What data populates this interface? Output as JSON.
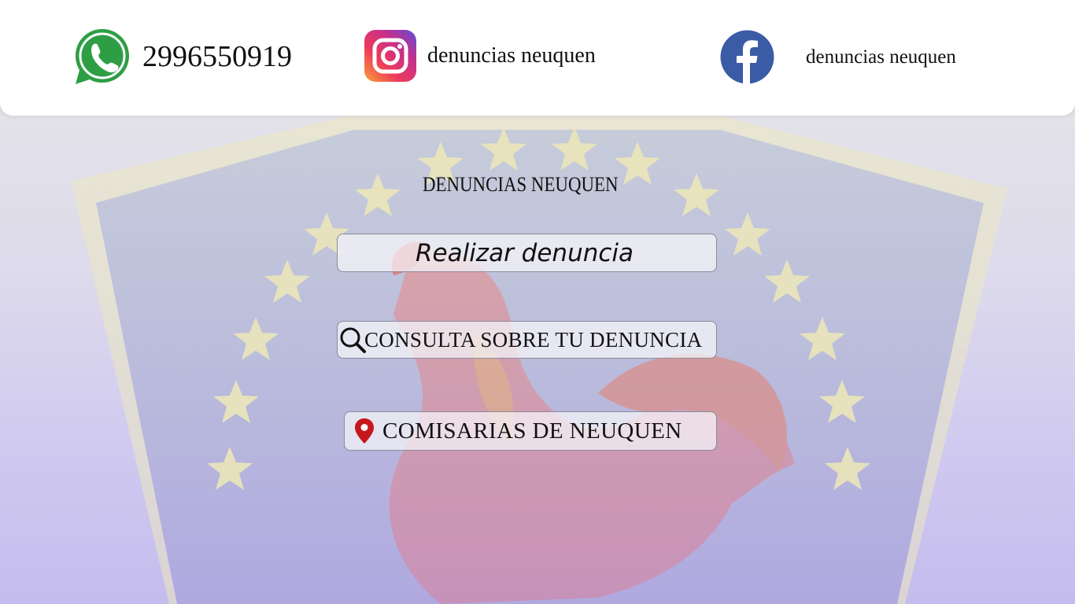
{
  "header": {
    "whatsapp": {
      "icon": "whatsapp-icon",
      "number": "2996550919",
      "color": "#2e9e45"
    },
    "instagram": {
      "icon": "instagram-icon",
      "handle": "denuncias neuquen"
    },
    "facebook": {
      "icon": "facebook-icon",
      "handle": "denuncias neuquen",
      "color": "#3b5ba6"
    }
  },
  "main": {
    "title": "DENUNCIAS NEUQUEN",
    "buttons": {
      "realizar": "Realizar denuncia",
      "consulta": {
        "icon": "search-icon",
        "label": "CONSULTA SOBRE TU DENUNCIA"
      },
      "comisarias": {
        "icon": "map-pin-icon",
        "label": "COMISARIAS DE NEUQUEN",
        "icon_color": "#c8161d"
      }
    }
  },
  "background": {
    "image": "flag-with-rooster-illustration"
  }
}
